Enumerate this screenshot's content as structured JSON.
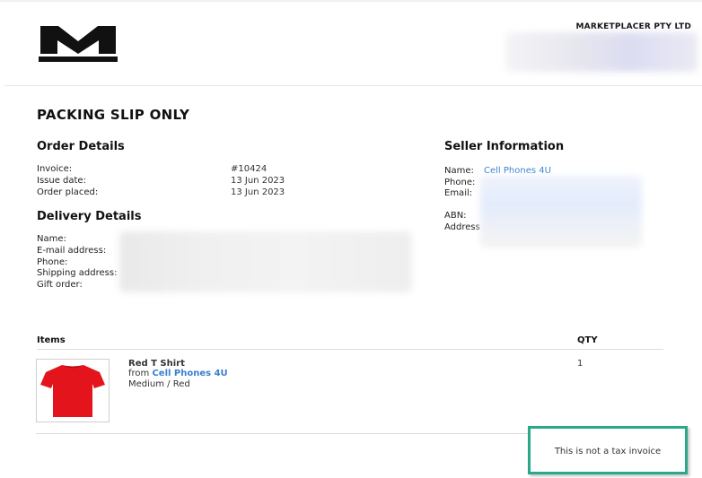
{
  "header": {
    "company": "MARKETPLACER PTY LTD",
    "logo_name": "marketplacer-logo"
  },
  "title": "PACKING SLIP ONLY",
  "order_details": {
    "heading": "Order Details",
    "invoice_label": "Invoice:",
    "invoice_value": "#10424",
    "issue_label": "Issue date:",
    "issue_value": "13 Jun 2023",
    "placed_label": "Order placed:",
    "placed_value": "13 Jun 2023"
  },
  "delivery_details": {
    "heading": "Delivery Details",
    "name_label": "Name:",
    "email_label": "E-mail address:",
    "phone_label": "Phone:",
    "shipping_label": "Shipping address:",
    "gift_label": "Gift order:"
  },
  "seller_information": {
    "heading": "Seller Information",
    "name_label": "Name:",
    "name_value": "Cell Phones 4U",
    "phone_label": "Phone:",
    "email_label": "Email:",
    "abn_label": "ABN:",
    "address_label": "Address"
  },
  "items": {
    "heading": "Items",
    "qty_heading": "QTY",
    "rows": [
      {
        "name": "Red T Shirt",
        "from_label": "from",
        "seller": "Cell Phones 4U",
        "variant": "Medium / Red",
        "qty": "1"
      }
    ]
  },
  "footer_note": "This is not a tax invoice",
  "colors": {
    "link": "#3a7fd0",
    "highlight_border": "#2aa88a",
    "product_red": "#e3141c"
  }
}
